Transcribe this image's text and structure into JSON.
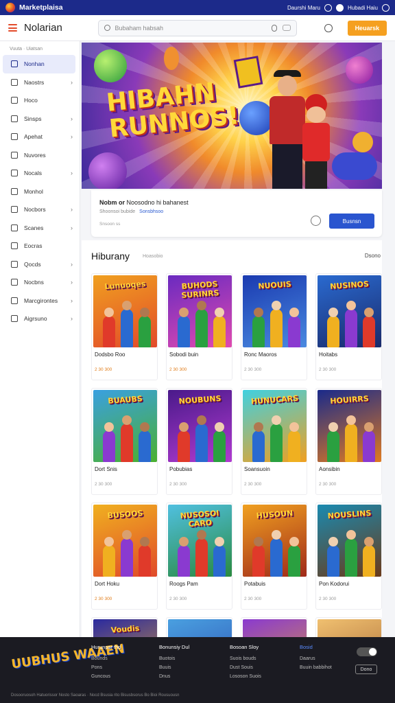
{
  "topbar": {
    "brand": "Marketplaisa",
    "user_text": "Daurshi Maru",
    "account_label": "Hubadi Haiu"
  },
  "header": {
    "title": "Nolarian",
    "search_placeholder": "Bubaham habsah",
    "cta_label": "Heuarsk"
  },
  "sidebar": {
    "breadcrumb": "Vuuta  ·  Uiatsan",
    "items": [
      {
        "label": "Nonhan",
        "icon": "page-icon",
        "active": true,
        "chevron": false
      },
      {
        "label": "Naostrs",
        "icon": "image-icon",
        "active": false,
        "chevron": true
      },
      {
        "label": "Hoco",
        "icon": "book-icon",
        "active": false,
        "chevron": false
      },
      {
        "label": "Sinsps",
        "icon": "tag-icon",
        "active": false,
        "chevron": true
      },
      {
        "label": "Apehat",
        "icon": "rocket-icon",
        "active": false,
        "chevron": true
      },
      {
        "label": "Nuvores",
        "icon": "clock-icon",
        "active": false,
        "chevron": false
      },
      {
        "label": "Nocals",
        "icon": "check-circle-icon",
        "active": false,
        "chevron": true
      },
      {
        "label": "Monhol",
        "icon": "bag-icon",
        "active": false,
        "chevron": false
      },
      {
        "label": "Nocbors",
        "icon": "gamepad-icon",
        "active": false,
        "chevron": true
      },
      {
        "label": "Scanes",
        "icon": "tools-icon",
        "active": false,
        "chevron": true
      },
      {
        "label": "Eocras",
        "icon": "pen-icon",
        "active": false,
        "chevron": false
      },
      {
        "label": "Qocds",
        "icon": "box-icon",
        "active": false,
        "chevron": true
      },
      {
        "label": "Nocbns",
        "icon": "controller-icon",
        "active": false,
        "chevron": true
      },
      {
        "label": "Marcgirontes",
        "icon": "chart-icon",
        "active": false,
        "chevron": true
      },
      {
        "label": "Aigrsuno",
        "icon": "globe-icon",
        "active": false,
        "chevron": true
      }
    ]
  },
  "hero": {
    "headline_1": "HIBAHN",
    "headline_2": "RUNNOS!"
  },
  "info": {
    "title_bold": "Nobm or",
    "title_rest": "Noosodno hi bahanest",
    "subtitle": "Shoonsoi bubide",
    "link": "Sonsbhsoo",
    "meta": "Snsoon ss",
    "button": "Busnsn"
  },
  "section": {
    "title": "Hiburany",
    "subtitle": "Hoasobio",
    "see_all": "Dsono"
  },
  "cards": [
    {
      "name": "Dodsbo Roo",
      "price": "2 30 300",
      "orange": true,
      "art": "Lunuoqes",
      "bg": [
        "#f0a020",
        "#e24a2a"
      ]
    },
    {
      "name": "Sobodi buin",
      "price": "2 30 300",
      "orange": true,
      "art": "BUHODS SURINRS",
      "bg": [
        "#6a2ac0",
        "#e04ab0"
      ]
    },
    {
      "name": "Ronc Maoros",
      "price": "2 30 300",
      "orange": false,
      "art": "NUOUIS",
      "bg": [
        "#1a3ab0",
        "#4a8ae0"
      ]
    },
    {
      "name": "Hoitabs",
      "price": "2 30 300",
      "orange": false,
      "art": "NUSINOS",
      "bg": [
        "#2a6ad0",
        "#1a2a6a"
      ]
    },
    {
      "name": "Dort Snis",
      "price": "2 30 300",
      "orange": false,
      "art": "BUAUBS",
      "bg": [
        "#3aa0e0",
        "#4ab030"
      ]
    },
    {
      "name": "Pobubias",
      "price": "2 30 300",
      "orange": false,
      "art": "NOUBUNS",
      "bg": [
        "#4a1a8a",
        "#b03ad0"
      ]
    },
    {
      "name": "Soansuoin",
      "price": "2 30 300",
      "orange": false,
      "art": "HUNUCARS",
      "bg": [
        "#40d0e0",
        "#f0a020"
      ]
    },
    {
      "name": "Aonsibin",
      "price": "2 30 300",
      "orange": false,
      "art": "HOUIRRS",
      "bg": [
        "#1a2a8a",
        "#e07a20"
      ]
    },
    {
      "name": "Dort Hoku",
      "price": "2 30 300",
      "orange": true,
      "art": "BUSOOS",
      "bg": [
        "#f0b020",
        "#e04a2a"
      ]
    },
    {
      "name": "Roogs Pam",
      "price": "2 30 300",
      "orange": false,
      "art": "NUSOSOI CARO",
      "bg": [
        "#50c0e0",
        "#2a8a40"
      ]
    },
    {
      "name": "Potabuis",
      "price": "2 30 300",
      "orange": false,
      "art": "HUSOUN",
      "bg": [
        "#f0a020",
        "#a02a1a"
      ]
    },
    {
      "name": "Pon Kodorui",
      "price": "2 30 300",
      "orange": false,
      "art": "NOUSLINS",
      "bg": [
        "#1a8ab0",
        "#6a3a1a"
      ]
    },
    {
      "name": "",
      "price": "",
      "orange": false,
      "art": "Voudis",
      "bg": [
        "#2a2aa0",
        "#e0a030"
      ]
    },
    {
      "name": "",
      "price": "",
      "orange": false,
      "art": "",
      "bg": [
        "#4aa0e0",
        "#2a4ab0"
      ]
    },
    {
      "name": "",
      "price": "",
      "orange": false,
      "art": "",
      "bg": [
        "#8a3ad0",
        "#e0a030"
      ]
    },
    {
      "name": "",
      "price": "",
      "orange": false,
      "art": "",
      "bg": [
        "#f0c070",
        "#a06030"
      ]
    }
  ],
  "footer": {
    "logo": "UUBHUS WAAEN",
    "columns": [
      {
        "heading": "Hurunpsr thd",
        "links": [
          "Bounds",
          "Pons",
          "Guncous"
        ]
      },
      {
        "heading": "Bonunsiy Dul",
        "links": [
          "Buotois",
          "Buuis",
          "Dnus"
        ]
      },
      {
        "heading": "Bosoan Sloy",
        "links": [
          "Suois bouds",
          "Dust Souis",
          "Lososon Suois"
        ]
      },
      {
        "heading": "Bosid",
        "links": [
          "Daarus",
          "Buuin babbihot"
        ]
      }
    ],
    "button": "Dono",
    "copyright": "Dosooruosoh Hatuorissor Nosto Saoaras · Nocd Bsusia rito Bisusbsorus Bo Bioi Rousuousn"
  }
}
